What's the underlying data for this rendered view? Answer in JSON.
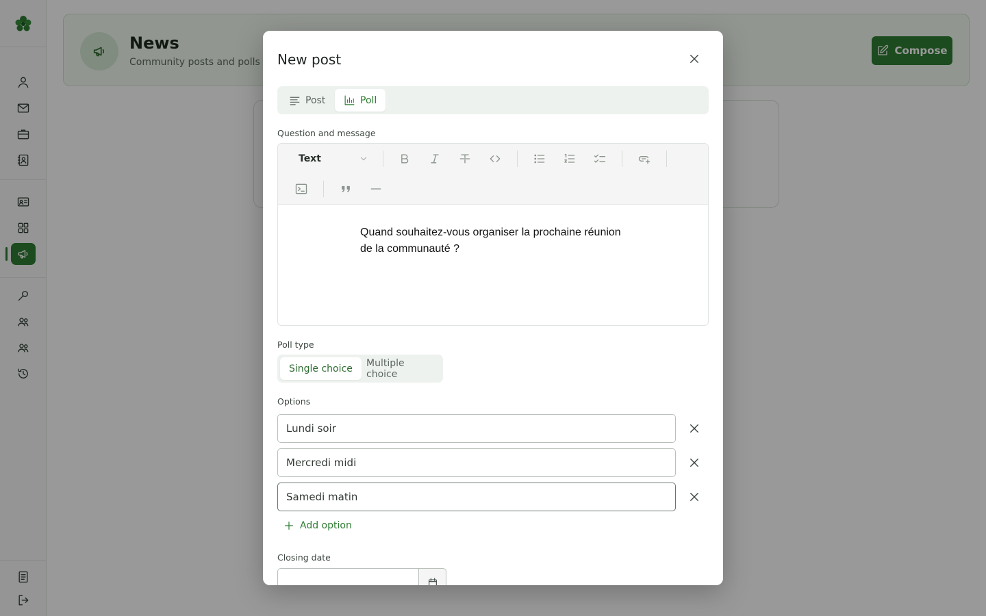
{
  "page": {
    "title": "News",
    "subtitle": "Community posts and polls",
    "compose_label": "Compose"
  },
  "sidebar": {
    "items": [
      {
        "name": "profile",
        "icon": "user-icon"
      },
      {
        "name": "mail",
        "icon": "mail-icon"
      },
      {
        "name": "work",
        "icon": "briefcase-icon"
      },
      {
        "name": "contacts",
        "icon": "contact-book-icon"
      },
      {
        "name": "id-card",
        "icon": "id-card-icon"
      },
      {
        "name": "apps",
        "icon": "grid-icon"
      },
      {
        "name": "news",
        "icon": "megaphone-icon",
        "active": true
      },
      {
        "name": "tools",
        "icon": "wrench-icon"
      },
      {
        "name": "groups",
        "icon": "users-icon"
      },
      {
        "name": "members",
        "icon": "users-icon"
      },
      {
        "name": "history",
        "icon": "history-icon"
      },
      {
        "name": "docs",
        "icon": "document-icon"
      },
      {
        "name": "logout",
        "icon": "logout-icon"
      }
    ]
  },
  "modal": {
    "title": "New post",
    "tabs": [
      {
        "label": "Post",
        "icon": "text-lines-icon",
        "active": false
      },
      {
        "label": "Poll",
        "icon": "bar-chart-icon",
        "active": true
      }
    ],
    "question_label": "Question and message",
    "editor": {
      "block_type": "Text",
      "content_line1": "Quand souhaitez-vous organiser la prochaine réunion",
      "content_line2": "de la communauté ?"
    },
    "poll_type_label": "Poll type",
    "poll_types": [
      {
        "label": "Single choice",
        "active": true
      },
      {
        "label": "Multiple choice",
        "active": false
      }
    ],
    "options_label": "Options",
    "options": [
      {
        "value": "Lundi soir"
      },
      {
        "value": "Mercredi midi"
      },
      {
        "value": "Samedi matin"
      }
    ],
    "add_option_label": "Add option",
    "closing_date_label": "Closing date",
    "closing_date_value": ""
  },
  "colors": {
    "accent": "#2e7d32",
    "overlay": "rgba(0,0,0,0.4)"
  }
}
